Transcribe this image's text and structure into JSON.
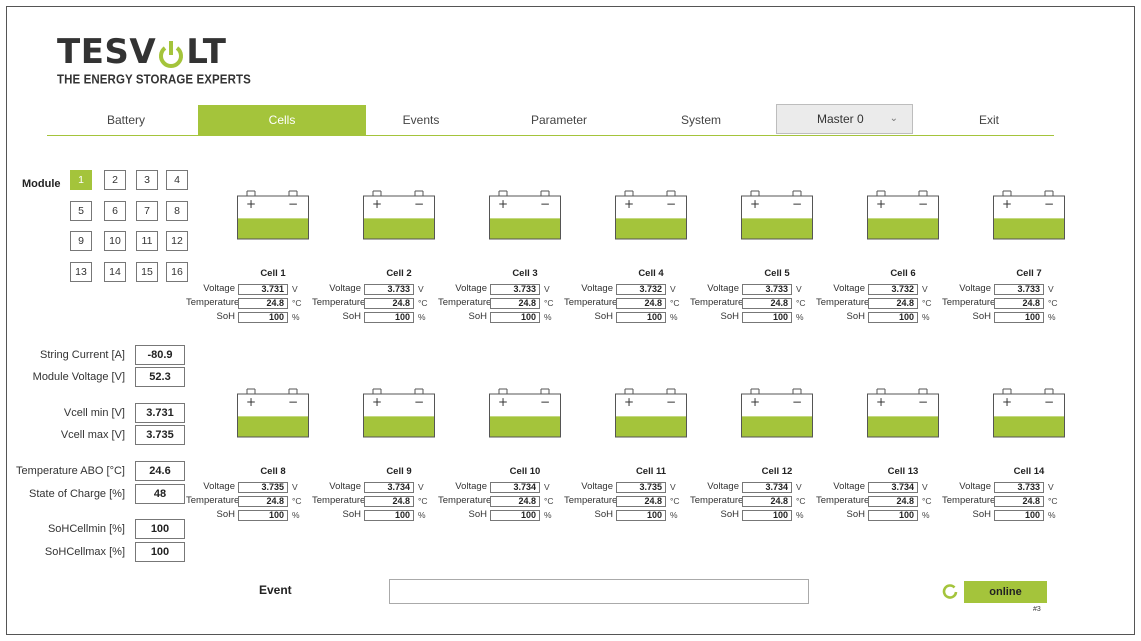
{
  "logo": {
    "word_left": "TESV",
    "word_right": "LT",
    "tagline": "THE ENERGY STORAGE EXPERTS"
  },
  "colors": {
    "accent": "#a4c43b",
    "fill": "#a4c43b",
    "border": "#555555"
  },
  "nav": {
    "tabs": [
      "Battery",
      "Cells",
      "Events",
      "Parameter",
      "System"
    ],
    "active_tab": "Cells",
    "master_select": "Master 0",
    "exit": "Exit"
  },
  "module": {
    "label": "Module",
    "items": [
      "1",
      "2",
      "3",
      "4",
      "5",
      "6",
      "7",
      "8",
      "9",
      "10",
      "11",
      "12",
      "13",
      "14",
      "15",
      "16"
    ],
    "active": "1"
  },
  "stats": [
    {
      "label": "String Current [A]",
      "value": "-80.9"
    },
    {
      "label": "Module Voltage [V]",
      "value": "52.3"
    },
    {
      "label": "Vcell min [V]",
      "value": "3.731"
    },
    {
      "label": "Vcell max [V]",
      "value": "3.735"
    },
    {
      "label": "Temperature ABO [°C]",
      "value": "24.6"
    },
    {
      "label": "State of Charge [%]",
      "value": "48"
    },
    {
      "label": "SoHCellmin [%]",
      "value": "100"
    },
    {
      "label": "SoHCellmax [%]",
      "value": "100"
    }
  ],
  "row_labels": {
    "voltage": "Voltage",
    "temperature": "Temperature",
    "soh": "SoH"
  },
  "units": {
    "voltage": "V",
    "temperature": "°C",
    "soh": "%"
  },
  "battery_icon": {
    "plus": "+",
    "minus": "−"
  },
  "state_of_charge_fraction": 0.48,
  "cells": [
    {
      "name": "Cell 1",
      "voltage": "3.731",
      "temperature": "24.8",
      "soh": "100"
    },
    {
      "name": "Cell 2",
      "voltage": "3.733",
      "temperature": "24.8",
      "soh": "100"
    },
    {
      "name": "Cell 3",
      "voltage": "3.733",
      "temperature": "24.8",
      "soh": "100"
    },
    {
      "name": "Cell 4",
      "voltage": "3.732",
      "temperature": "24.8",
      "soh": "100"
    },
    {
      "name": "Cell 5",
      "voltage": "3.733",
      "temperature": "24.8",
      "soh": "100"
    },
    {
      "name": "Cell 6",
      "voltage": "3.732",
      "temperature": "24.8",
      "soh": "100"
    },
    {
      "name": "Cell 7",
      "voltage": "3.733",
      "temperature": "24.8",
      "soh": "100"
    },
    {
      "name": "Cell 8",
      "voltage": "3.735",
      "temperature": "24.8",
      "soh": "100"
    },
    {
      "name": "Cell 9",
      "voltage": "3.734",
      "temperature": "24.8",
      "soh": "100"
    },
    {
      "name": "Cell 10",
      "voltage": "3.734",
      "temperature": "24.8",
      "soh": "100"
    },
    {
      "name": "Cell 11",
      "voltage": "3.735",
      "temperature": "24.8",
      "soh": "100"
    },
    {
      "name": "Cell 12",
      "voltage": "3.734",
      "temperature": "24.8",
      "soh": "100"
    },
    {
      "name": "Cell 13",
      "voltage": "3.734",
      "temperature": "24.8",
      "soh": "100"
    },
    {
      "name": "Cell 14",
      "voltage": "3.733",
      "temperature": "24.8",
      "soh": "100"
    }
  ],
  "event": {
    "label": "Event",
    "value": ""
  },
  "status": {
    "label": "online",
    "sub": "#3"
  }
}
